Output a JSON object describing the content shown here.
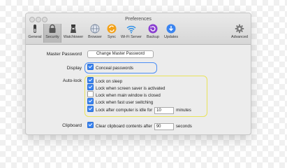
{
  "window": {
    "title": "Preferences"
  },
  "toolbar": {
    "items": [
      {
        "label": "General",
        "icon": "switch-icon"
      },
      {
        "label": "Security",
        "icon": "lock-icon",
        "selected": true
      },
      {
        "label": "Watchtower",
        "icon": "watchtower-icon"
      },
      {
        "label": "Browser",
        "icon": "globe-icon"
      },
      {
        "label": "Sync",
        "icon": "sync-icon"
      },
      {
        "label": "Wi-Fi Server",
        "icon": "wifi-icon"
      },
      {
        "label": "Backup",
        "icon": "backup-icon"
      },
      {
        "label": "Updates",
        "icon": "download-icon"
      },
      {
        "label": "Advanced",
        "icon": "gear-icon"
      }
    ]
  },
  "master_password": {
    "label": "Master Password",
    "button": "Change Master Password"
  },
  "display": {
    "label": "Display",
    "conceal": "Conceal passwords",
    "conceal_checked": true
  },
  "autolock": {
    "label": "Auto-lock",
    "options": [
      {
        "text": "Lock on sleep",
        "checked": true
      },
      {
        "text": "Lock when screen saver is activated",
        "checked": true
      },
      {
        "text": "Lock when main window is closed",
        "checked": false
      },
      {
        "text": "Lock when fast user switching",
        "checked": true
      }
    ],
    "idle": {
      "text": "Lock after computer is idle for",
      "value": "10",
      "unit": "minutes",
      "checked": true
    }
  },
  "clipboard": {
    "label": "Clipboard",
    "text": "Clear clipboard contents after",
    "value": "90",
    "unit": "seconds",
    "checked": true
  },
  "colors": {
    "accent": "#3a84f0",
    "highlight_blue": "#4c8ef5",
    "highlight_yellow": "#e8e35a"
  }
}
